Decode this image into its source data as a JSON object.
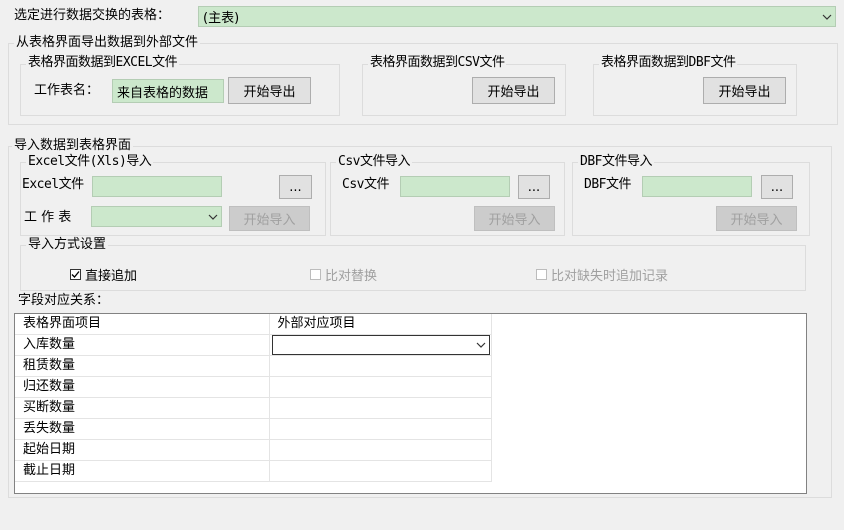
{
  "top": {
    "table_label": "选定进行数据交换的表格：",
    "table_value": "(主表)"
  },
  "export": {
    "title": "从表格界面导出数据到外部文件",
    "excel": {
      "title": "表格界面数据到EXCEL文件",
      "sheet_label": "工作表名：",
      "sheet_value": "来自表格的数据",
      "button": "开始导出"
    },
    "csv": {
      "title": "表格界面数据到CSV文件",
      "button": "开始导出"
    },
    "dbf": {
      "title": "表格界面数据到DBF文件",
      "button": "开始导出"
    }
  },
  "import": {
    "title": "导入数据到表格界面",
    "excel": {
      "title": "Excel文件(Xls)导入",
      "file_label": "Excel文件",
      "browse": "...",
      "sheet_label": "工 作 表",
      "button": "开始导入"
    },
    "csv": {
      "title": "Csv文件导入",
      "file_label": "Csv文件",
      "browse": "...",
      "button": "开始导入"
    },
    "dbf": {
      "title": "DBF文件导入",
      "file_label": "DBF文件",
      "browse": "...",
      "button": "开始导入"
    },
    "mode": {
      "title": "导入方式设置",
      "options": [
        {
          "label": "直接追加",
          "checked": true,
          "enabled": true
        },
        {
          "label": "比对替换",
          "checked": false,
          "enabled": false
        },
        {
          "label": "比对缺失时追加记录",
          "checked": false,
          "enabled": false
        }
      ]
    }
  },
  "mapping": {
    "label": "字段对应关系：",
    "headers": [
      "表格界面项目",
      "外部对应项目"
    ],
    "rows": [
      "入库数量",
      "租赁数量",
      "归还数量",
      "买断数量",
      "丢失数量",
      "起始日期",
      "截止日期"
    ]
  },
  "colors": {
    "field_bg": "#cce8cc",
    "window_bg": "#f0f0f0"
  }
}
